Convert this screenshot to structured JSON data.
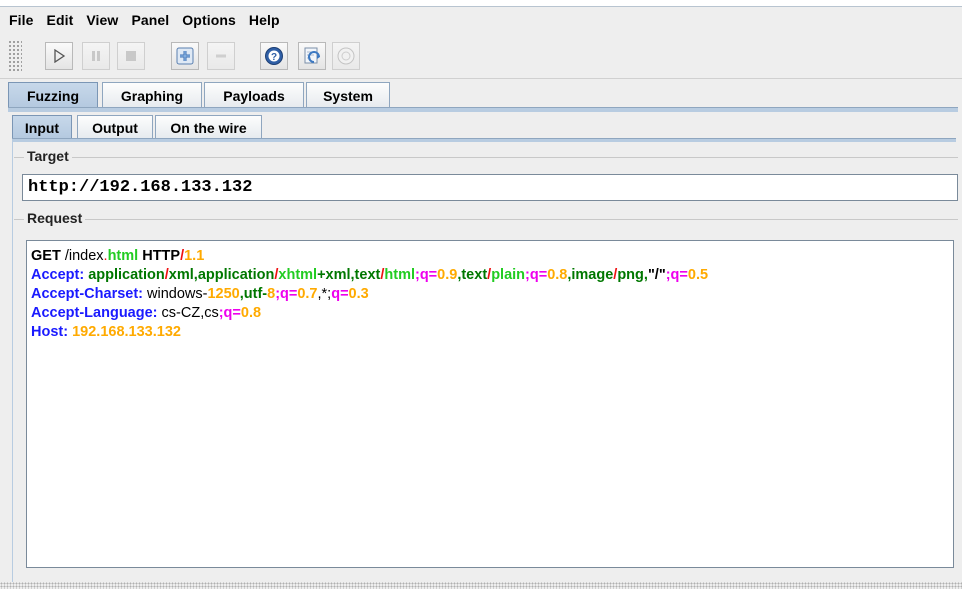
{
  "menubar": {
    "items": [
      {
        "label": "File"
      },
      {
        "label": "Edit"
      },
      {
        "label": "View"
      },
      {
        "label": "Panel"
      },
      {
        "label": "Options"
      },
      {
        "label": "Help"
      }
    ]
  },
  "toolbar": {
    "buttons": [
      {
        "icon": "play-icon",
        "enabled": true
      },
      {
        "icon": "pause-icon",
        "enabled": false
      },
      {
        "icon": "stop-icon",
        "enabled": false
      },
      {
        "icon": "plus-icon",
        "enabled": true
      },
      {
        "icon": "minus-icon",
        "enabled": false
      },
      {
        "icon": "help-icon",
        "enabled": true
      },
      {
        "icon": "refresh-icon",
        "enabled": true
      },
      {
        "icon": "record-icon",
        "enabled": false
      }
    ]
  },
  "main_tabs": [
    {
      "label": "Fuzzing",
      "active": true
    },
    {
      "label": "Graphing",
      "active": false
    },
    {
      "label": "Payloads",
      "active": false
    },
    {
      "label": "System",
      "active": false
    }
  ],
  "sub_tabs": [
    {
      "label": "Input",
      "active": true
    },
    {
      "label": "Output",
      "active": false
    },
    {
      "label": "On the wire",
      "active": false
    }
  ],
  "target": {
    "title": "Target",
    "value": "http://192.168.133.132"
  },
  "request": {
    "title": "Request",
    "colors": {
      "keyword": "#000000",
      "header": "#1a1aff",
      "value": "#007700",
      "separator": "#ee1111",
      "subtype": "#22cc22",
      "param": "#ee00ee",
      "number": "#ffaa00",
      "plain": "#000000"
    },
    "lines": [
      [
        {
          "t": "GET",
          "c": "keyword",
          "b": true
        },
        {
          "t": " /index",
          "c": "plain",
          "b": false
        },
        {
          "t": ".",
          "c": "separator",
          "b": false
        },
        {
          "t": "html",
          "c": "subtype",
          "b": true
        },
        {
          "t": " ",
          "c": "plain",
          "b": false
        },
        {
          "t": "HTTP",
          "c": "keyword",
          "b": true
        },
        {
          "t": "/",
          "c": "separator",
          "b": true
        },
        {
          "t": "1.1",
          "c": "number",
          "b": true
        }
      ],
      [
        {
          "t": "Accept",
          "c": "header",
          "b": true
        },
        {
          "t": ": ",
          "c": "header",
          "b": true
        },
        {
          "t": "application",
          "c": "value",
          "b": true
        },
        {
          "t": "/",
          "c": "separator",
          "b": true
        },
        {
          "t": "xml",
          "c": "value",
          "b": true
        },
        {
          "t": ",application",
          "c": "value",
          "b": true
        },
        {
          "t": "/",
          "c": "separator",
          "b": true
        },
        {
          "t": "xhtml",
          "c": "subtype",
          "b": true
        },
        {
          "t": "+xml,text",
          "c": "value",
          "b": true
        },
        {
          "t": "/",
          "c": "separator",
          "b": true
        },
        {
          "t": "html",
          "c": "subtype",
          "b": true
        },
        {
          "t": ";q=",
          "c": "param",
          "b": true
        },
        {
          "t": "0.9",
          "c": "number",
          "b": true
        },
        {
          "t": ",text",
          "c": "value",
          "b": true
        },
        {
          "t": "/",
          "c": "separator",
          "b": true
        },
        {
          "t": "plain",
          "c": "subtype",
          "b": true
        },
        {
          "t": ";q=",
          "c": "param",
          "b": true
        },
        {
          "t": "0.8",
          "c": "number",
          "b": true
        },
        {
          "t": ",image",
          "c": "value",
          "b": true
        },
        {
          "t": "/",
          "c": "separator",
          "b": true
        },
        {
          "t": "png,",
          "c": "value",
          "b": true
        },
        {
          "t": "\"/\"",
          "c": "plain",
          "b": true
        },
        {
          "t": ";q=",
          "c": "param",
          "b": true
        },
        {
          "t": "0.5",
          "c": "number",
          "b": true
        }
      ],
      [
        {
          "t": "Accept-Charset",
          "c": "header",
          "b": true
        },
        {
          "t": ": ",
          "c": "header",
          "b": true
        },
        {
          "t": "windows-",
          "c": "plain",
          "b": false
        },
        {
          "t": "1250",
          "c": "number",
          "b": true
        },
        {
          "t": ",utf-",
          "c": "value",
          "b": true
        },
        {
          "t": "8",
          "c": "number",
          "b": true
        },
        {
          "t": ";q=",
          "c": "param",
          "b": true
        },
        {
          "t": "0.7",
          "c": "number",
          "b": true
        },
        {
          "t": ",*;",
          "c": "plain",
          "b": false
        },
        {
          "t": "q=",
          "c": "param",
          "b": true
        },
        {
          "t": "0.3",
          "c": "number",
          "b": true
        }
      ],
      [
        {
          "t": "Accept-Language",
          "c": "header",
          "b": true
        },
        {
          "t": ": ",
          "c": "header",
          "b": true
        },
        {
          "t": "cs-CZ,cs",
          "c": "plain",
          "b": false
        },
        {
          "t": ";q=",
          "c": "param",
          "b": true
        },
        {
          "t": "0.8",
          "c": "number",
          "b": true
        }
      ],
      [
        {
          "t": "Host",
          "c": "header",
          "b": true
        },
        {
          "t": ": ",
          "c": "header",
          "b": true
        },
        {
          "t": "192.168.133.132",
          "c": "number",
          "b": true
        }
      ]
    ]
  }
}
